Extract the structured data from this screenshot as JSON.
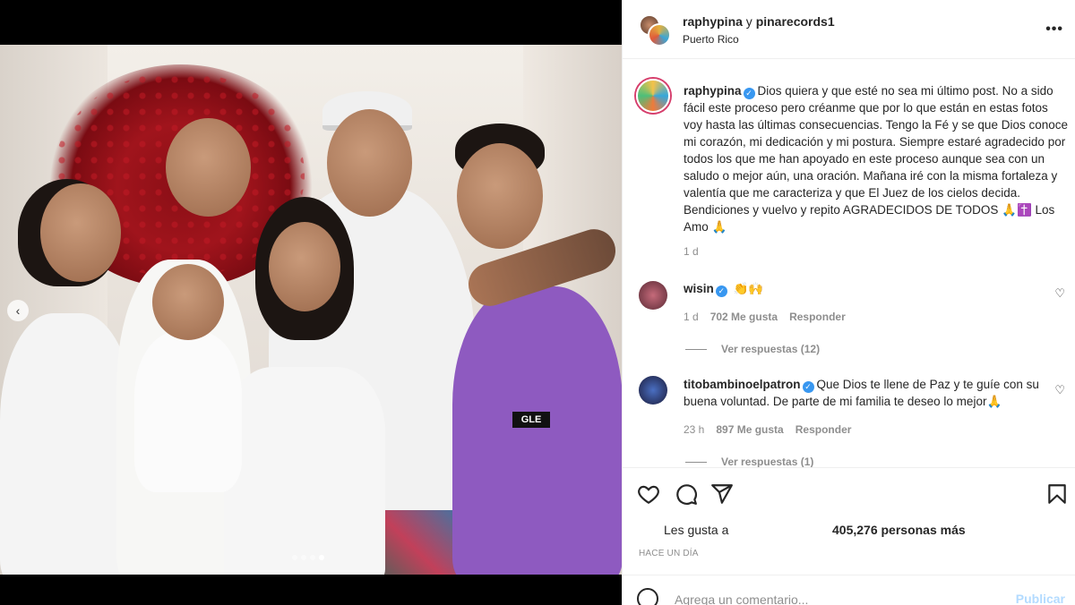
{
  "post": {
    "owners_user1": "raphypina",
    "owners_sep": " y ",
    "owners_user2": "pinarecords1",
    "location": "Puerto Rico",
    "more_icon": "more-horizontal-icon",
    "carousel": {
      "dots": 4,
      "active_dot": 4
    }
  },
  "caption": {
    "username": "raphypina",
    "text": "Dios quiera y que esté no sea mi último post. No a sido fácil este proceso pero créanme que por lo que están en estas fotos voy hasta las últimas consecuencias. Tengo la Fé y se que Dios conoce mi corazón, mi dedicación y mi postura. Siempre estaré agradecido por todos los que me han apoyado en este proceso aunque sea con un saludo o mejor aún, una oración. Mañana iré con la misma fortaleza y valentía que me caracteriza y que El Juez de los cielos decida. Bendiciones y vuelvo y repito AGRADECIDOS DE TODOS 🙏✝️ Los Amo 🙏",
    "time": "1 d"
  },
  "comments": [
    {
      "username": "wisin",
      "text": "👏🙌",
      "time": "1 d",
      "likes": "702 Me gusta",
      "reply": "Responder",
      "view_replies": "Ver respuestas (12)"
    },
    {
      "username": "titobambinoelpatron",
      "text": "Que Dios te llene de Paz y te guíe con su buena voluntad. De parte de mi familia te deseo lo mejor🙏",
      "time": "23 h",
      "likes": "897 Me gusta",
      "reply": "Responder",
      "view_replies": "Ver respuestas (1)"
    }
  ],
  "likes": {
    "label": "Les gusta a",
    "count": "405,276 personas más"
  },
  "timestamp": "HACE UN DÍA",
  "comment_box": {
    "placeholder": "Agrega un comentario...",
    "publish": "Publicar"
  },
  "photo": {
    "shirt_text": "GLE"
  },
  "colors": {
    "accent": "#3897f0",
    "publish_disabled": "#b3dbff",
    "secondary_text": "#8e8e8e"
  }
}
